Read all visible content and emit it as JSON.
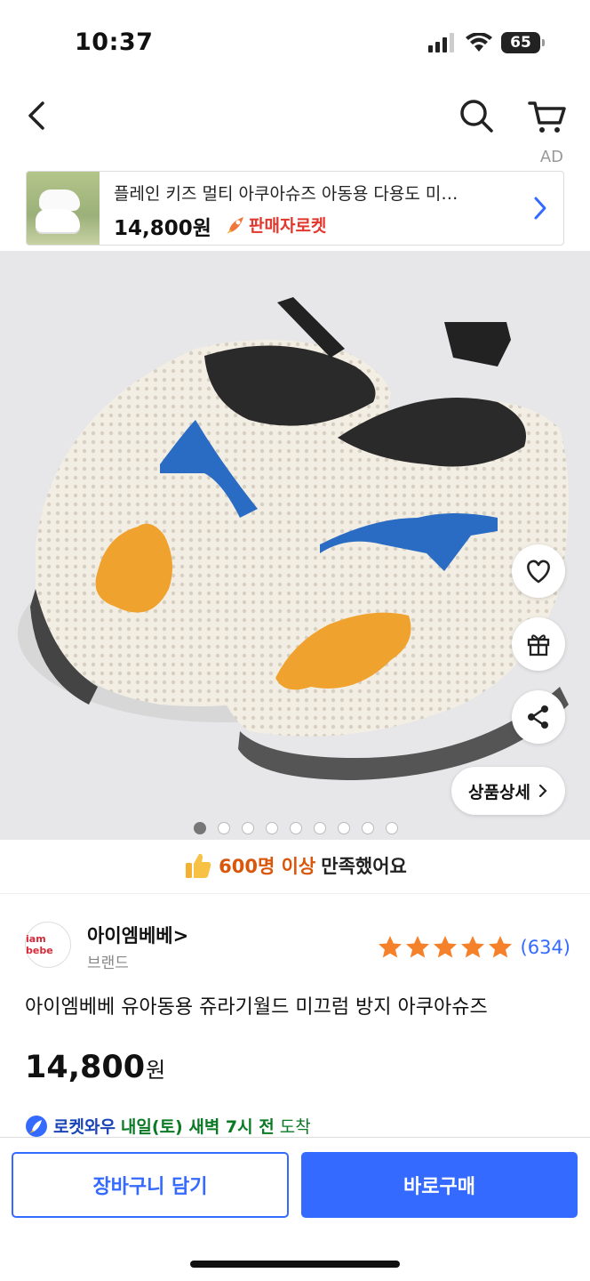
{
  "status": {
    "time": "10:37",
    "battery": "65"
  },
  "header": {
    "ad_label": "AD"
  },
  "ad": {
    "title": "플레인 키즈 멀티 아쿠아슈즈 아동용 다용도 미…",
    "price": "14,800원",
    "badge": "판매자로켓"
  },
  "gallery": {
    "total_images": 9,
    "active_index": 0
  },
  "actions": {
    "detail_label": "상품상세"
  },
  "satisfaction": {
    "count": "600명 이상",
    "text": "만족했어요"
  },
  "brand": {
    "logo_text": "iam bebe",
    "name": "아이엠베베",
    "type": "브랜드"
  },
  "rating": {
    "stars": 5,
    "review_count": "(634)"
  },
  "product": {
    "title": "아이엠베베 유아동용 쥬라기월드 미끄럼 방지 아쿠아슈즈",
    "price": "14,800",
    "price_unit": "원"
  },
  "delivery": {
    "badge": "로켓와우",
    "date": "내일(토) 새벽 7시 전",
    "arrive": "도착"
  },
  "buttons": {
    "cart": "장바구니 담기",
    "buy": "바로구매"
  },
  "colors": {
    "accent": "#346aff",
    "rocket_red": "#e3362c",
    "highlight_orange": "#d9570b",
    "delivery_green": "#0a7a24"
  }
}
